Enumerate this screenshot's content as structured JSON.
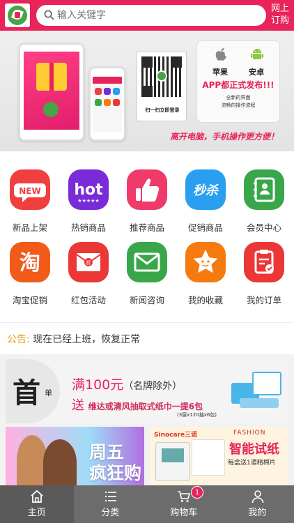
{
  "header": {
    "search_placeholder": "输入关键字",
    "order_link": "网上订购"
  },
  "banner": {
    "os_apple": "苹果",
    "os_android": "安卓",
    "headline": "APP都正式发布!!!",
    "sub1": "全新的界面",
    "sub2": "流畅的操作流程",
    "qr_caption": "扫一扫立即登录",
    "slogan": "离开电脑，手机操作更方便！",
    "slides": 3,
    "active_slide": 0
  },
  "grid": {
    "items": [
      {
        "label": "新品上架",
        "icon": "new-icon",
        "color": "#ef3f3f"
      },
      {
        "label": "热销商品",
        "icon": "hot-icon",
        "color": "#7a2bd8"
      },
      {
        "label": "推荐商品",
        "icon": "thumbs-up-icon",
        "color": "#f03a6a"
      },
      {
        "label": "促销商品",
        "icon": "flash-sale-icon",
        "color": "#2a9ff0"
      },
      {
        "label": "会员中心",
        "icon": "contacts-icon",
        "color": "#3aa64a"
      },
      {
        "label": "淘宝促销",
        "icon": "taobao-icon",
        "color": "#f25a1a"
      },
      {
        "label": "红包活动",
        "icon": "red-envelope-icon",
        "color": "#ec3737"
      },
      {
        "label": "新闻咨询",
        "icon": "mail-icon",
        "color": "#3aa64a"
      },
      {
        "label": "我的收藏",
        "icon": "star-icon",
        "color": "#f57a10"
      },
      {
        "label": "我的订单",
        "icon": "order-icon",
        "color": "#ec3737"
      }
    ]
  },
  "notice": {
    "prefix": "公告:",
    "text": "现在已经上班，恢复正常"
  },
  "ad": {
    "big_char": "首",
    "small_char": "单",
    "line1": "满100元",
    "line1_paren": "（名牌除外）",
    "line2": "送",
    "line2_rest": "维达或清风抽取式纸巾一提6包",
    "line3": "(3层x120抽x6包)"
  },
  "promo_left": {
    "title1": "周五",
    "title2": "疯狂购"
  },
  "promo_right": {
    "brand": "Sinocare三诺",
    "fashion": "FASHION",
    "title": "智能试纸",
    "desc": "每盒送1酒精棉片"
  },
  "tabbar": {
    "tabs": [
      {
        "label": "主页",
        "icon": "home-icon"
      },
      {
        "label": "分类",
        "icon": "list-icon"
      },
      {
        "label": "购物车",
        "icon": "cart-icon"
      },
      {
        "label": "我的",
        "icon": "user-icon"
      }
    ],
    "active": 0,
    "cart_badge": "1"
  }
}
